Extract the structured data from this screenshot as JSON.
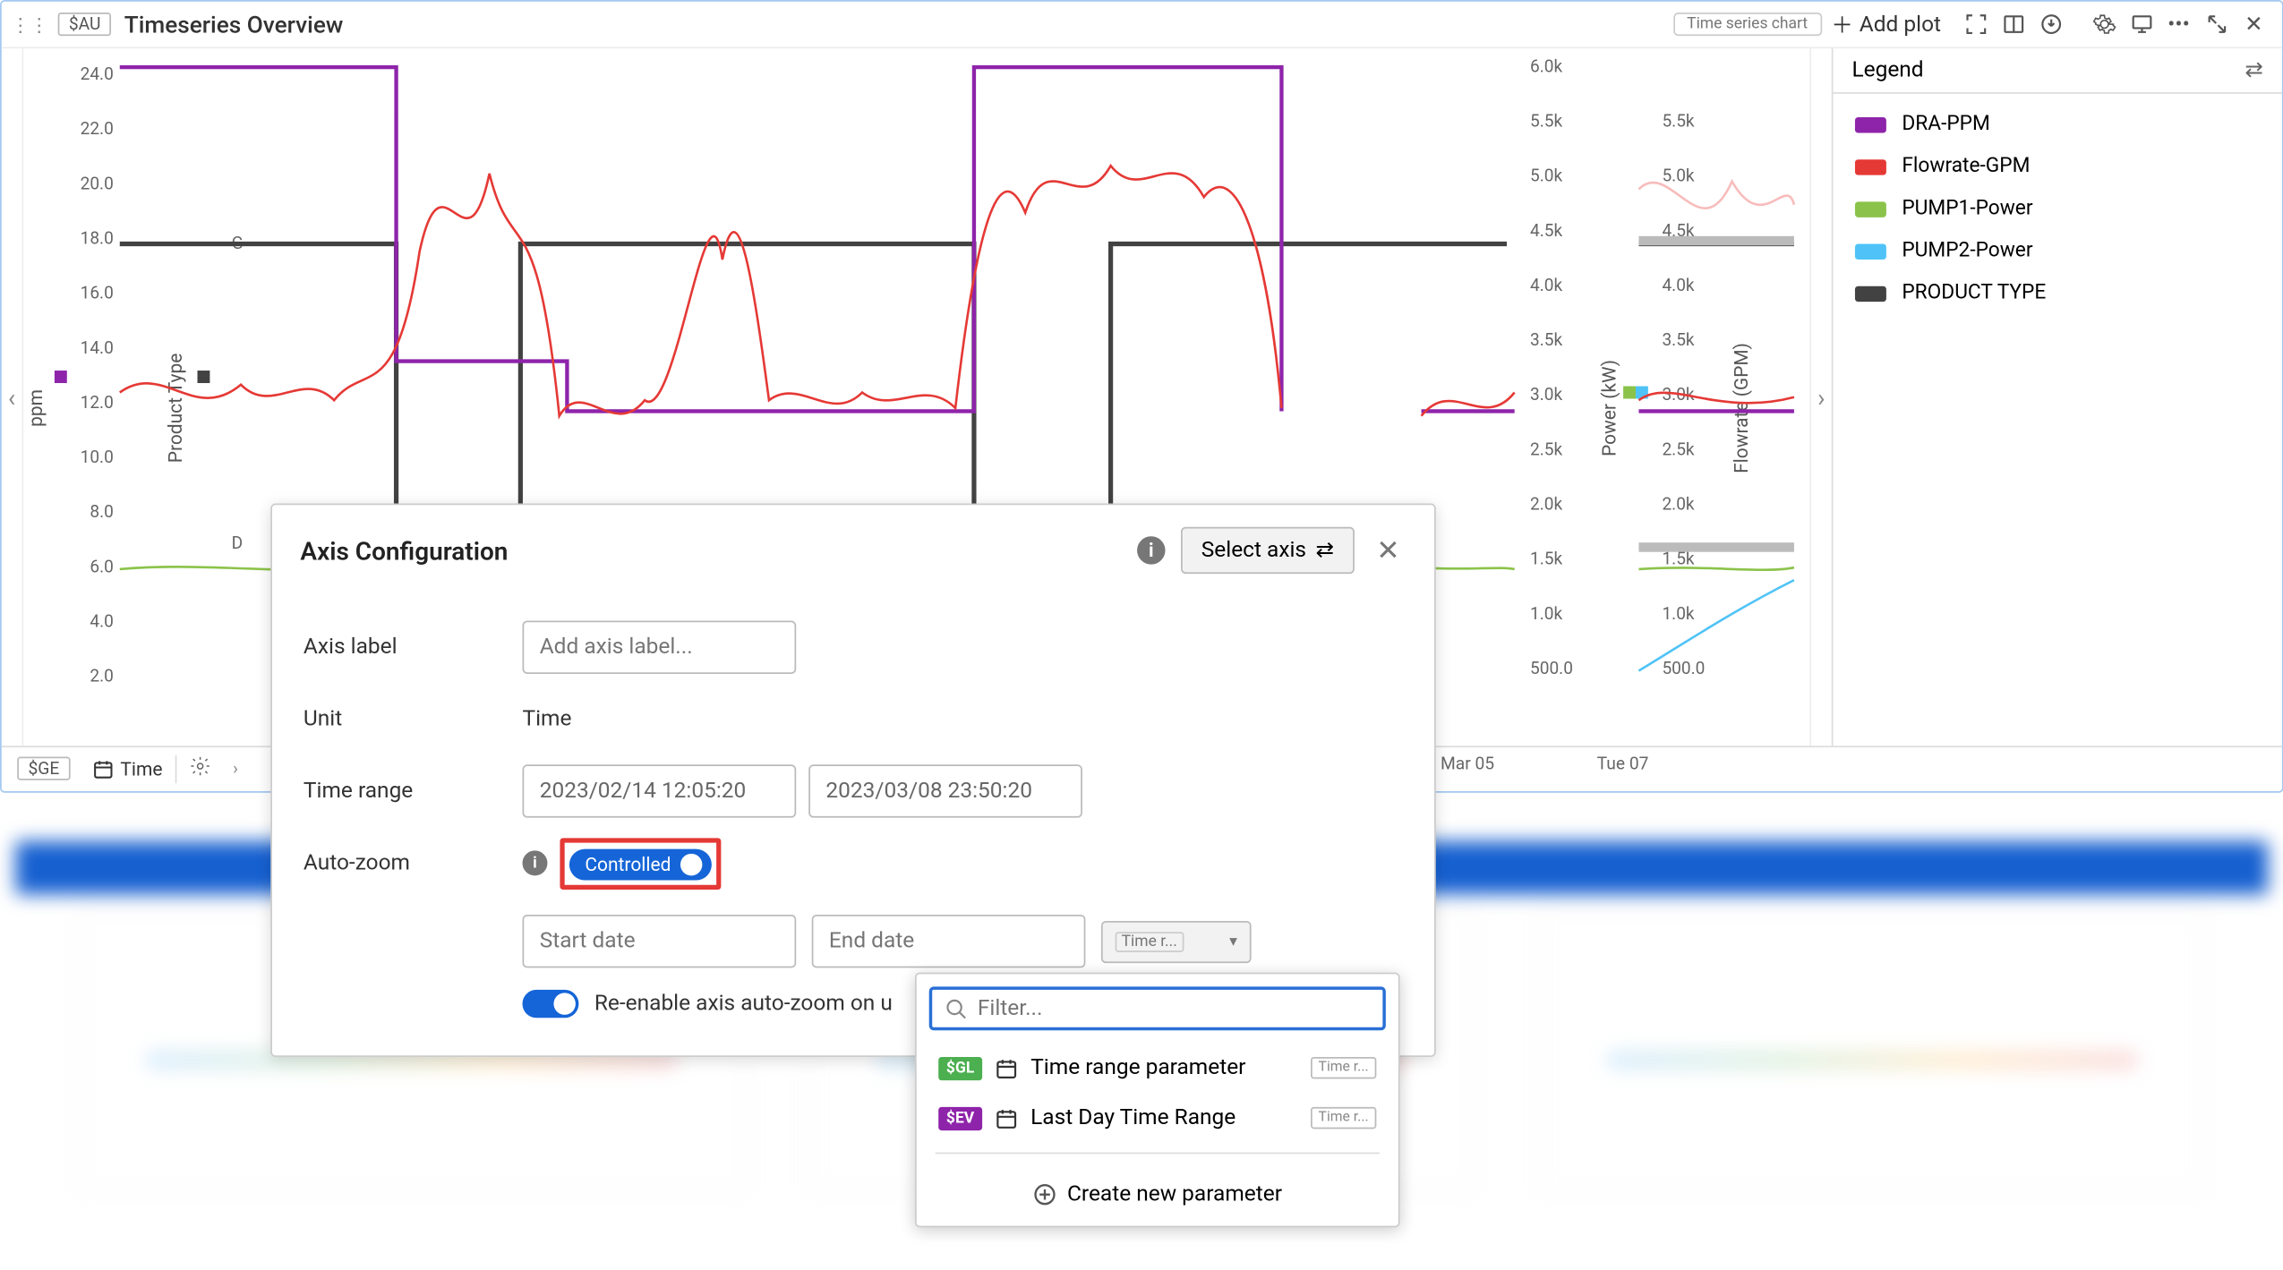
{
  "toolbar": {
    "au_badge": "$AU",
    "title": "Timeseries Overview",
    "ts_chip": "Time series chart",
    "add_plot": "Add plot"
  },
  "bottom_tabs": {
    "ge_badge": "$GE",
    "time_tab": "Time"
  },
  "legend": {
    "title": "Legend",
    "items": [
      {
        "label": "DRA-PPM",
        "color": "#8e24aa"
      },
      {
        "label": "Flowrate-GPM",
        "color": "#e53935"
      },
      {
        "label": "PUMP1-Power",
        "color": "#8bc34a"
      },
      {
        "label": "PUMP2-Power",
        "color": "#4fc3f7"
      },
      {
        "label": "PRODUCT TYPE",
        "color": "#424242"
      }
    ]
  },
  "modal": {
    "title": "Axis Configuration",
    "select_axis": "Select axis",
    "rows": {
      "axis_label": "Axis label",
      "axis_label_ph": "Add axis label...",
      "unit": "Unit",
      "unit_val": "Time",
      "time_range": "Time range",
      "tr_start": "2023/02/14 12:05:20",
      "tr_end": "2023/03/08 23:50:20",
      "auto_zoom": "Auto-zoom",
      "controlled": "Controlled",
      "start_ph": "Start date",
      "end_ph": "End date",
      "dd_label": "Time r...",
      "reenable": "Re-enable axis auto-zoom on u"
    }
  },
  "popover": {
    "filter_ph": "Filter...",
    "items": [
      {
        "tag": "$GL",
        "tag_class": "tag-gl",
        "label": "Time range parameter",
        "chip": "Time r..."
      },
      {
        "tag": "$EV",
        "tag_class": "tag-ev",
        "label": "Last Day Time Range",
        "chip": "Time r..."
      }
    ],
    "create": "Create new parameter"
  },
  "chart_data": {
    "type": "line",
    "axes": {
      "left_ppm": {
        "label": "ppm",
        "ticks": [
          2.0,
          4.0,
          6.0,
          8.0,
          10.0,
          12.0,
          14.0,
          16.0,
          18.0,
          20.0,
          22.0,
          24.0
        ]
      },
      "product_type": {
        "label": "Product Type",
        "levels": [
          "D",
          "G"
        ]
      },
      "right_power": {
        "label": "Power (kW)",
        "ticks": [
          500.0,
          "1.0k",
          "1.5k",
          "2.0k",
          "2.5k",
          "3.0k",
          "3.5k",
          "4.0k",
          "4.5k",
          "5.0k",
          "5.5k",
          "6.0k"
        ]
      },
      "right_flow": {
        "label": "Flowrate (GPM)",
        "ticks": [
          500.0,
          "1.0k",
          "1.5k",
          "2.0k",
          "2.5k",
          "3.0k",
          "3.5k",
          "4.0k",
          "4.5k",
          "5.0k",
          "5.5k"
        ]
      },
      "x_ticks": [
        "Mar 05",
        "Tue 07"
      ]
    },
    "series": [
      {
        "name": "DRA-PPM",
        "color": "#8e24aa",
        "axis": "left_ppm",
        "segments_approx_ppm": [
          25,
          25,
          25,
          13.8,
          13.8,
          12,
          12,
          25,
          25,
          25,
          12,
          12
        ]
      },
      {
        "name": "Flowrate-GPM",
        "color": "#e53935",
        "axis": "right_flow",
        "approx_values_gpm": [
          3200,
          3100,
          4600,
          4800,
          3100,
          3000,
          3100,
          4700,
          4900,
          4700,
          3200,
          3100
        ]
      },
      {
        "name": "PUMP1-Power",
        "color": "#8bc34a",
        "axis": "right_power",
        "approx_values_kw": [
          1500,
          1480,
          1520,
          1500,
          1510,
          1490,
          1500,
          1520,
          1500,
          1480,
          1520,
          1500
        ]
      },
      {
        "name": "PUMP2-Power",
        "color": "#4fc3f7",
        "axis": "right_power",
        "approx_values_kw": [
          null,
          null,
          null,
          500,
          520,
          510,
          null,
          null,
          null,
          500,
          510,
          520
        ]
      },
      {
        "name": "PRODUCT TYPE",
        "color": "#424242",
        "axis": "product_type",
        "level_sequence": [
          "G",
          "G",
          "D",
          "G",
          "G",
          "G",
          "D",
          "G"
        ]
      }
    ]
  }
}
